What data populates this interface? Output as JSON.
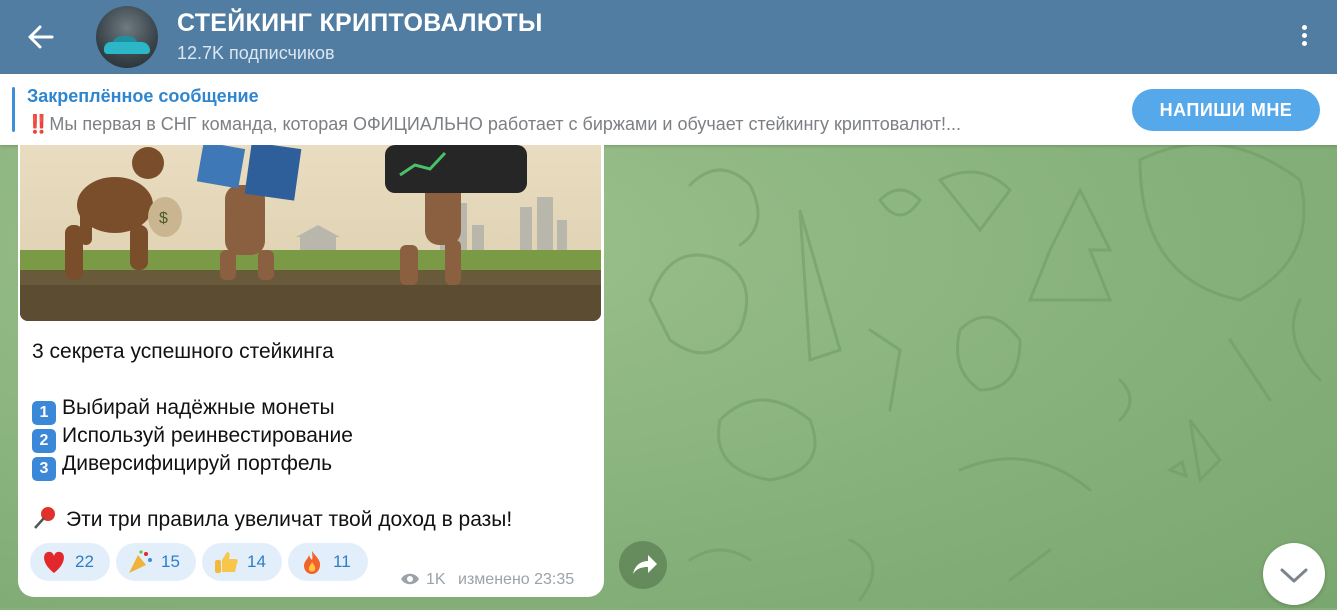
{
  "header": {
    "title": "СТЕЙКИНГ КРИПТОВАЛЮТЫ",
    "subscribers": "12.7K подписчиков"
  },
  "pinned": {
    "title": "Закреплённое сообщение",
    "prefix": "‼️",
    "text": "Мы первая в СНГ команда, которая ОФИЦИАЛЬНО работает с биржами и обучает стейкингу криптовалют!...",
    "button_label": "НАПИШИ МНЕ"
  },
  "message": {
    "heading": "3 секрета успешного стейкинга",
    "items": [
      {
        "num": "1",
        "text": "Выбирай надёжные монеты"
      },
      {
        "num": "2",
        "text": "Используй реинвестирование"
      },
      {
        "num": "3",
        "text": "Диверсифицируй портфель"
      }
    ],
    "footer_text": "Эти три правила увеличат твой доход в разы!",
    "reactions": [
      {
        "icon": "heart-icon",
        "count": "22"
      },
      {
        "icon": "party-popper-icon",
        "count": "15"
      },
      {
        "icon": "thumbs-up-icon",
        "count": "14"
      },
      {
        "icon": "fire-icon",
        "count": "11"
      }
    ],
    "views": "1K",
    "edited_time": "изменено 23:35"
  },
  "colors": {
    "header_bg": "#517da2",
    "accent": "#55a8ea",
    "pinned_title": "#2f86cf"
  }
}
